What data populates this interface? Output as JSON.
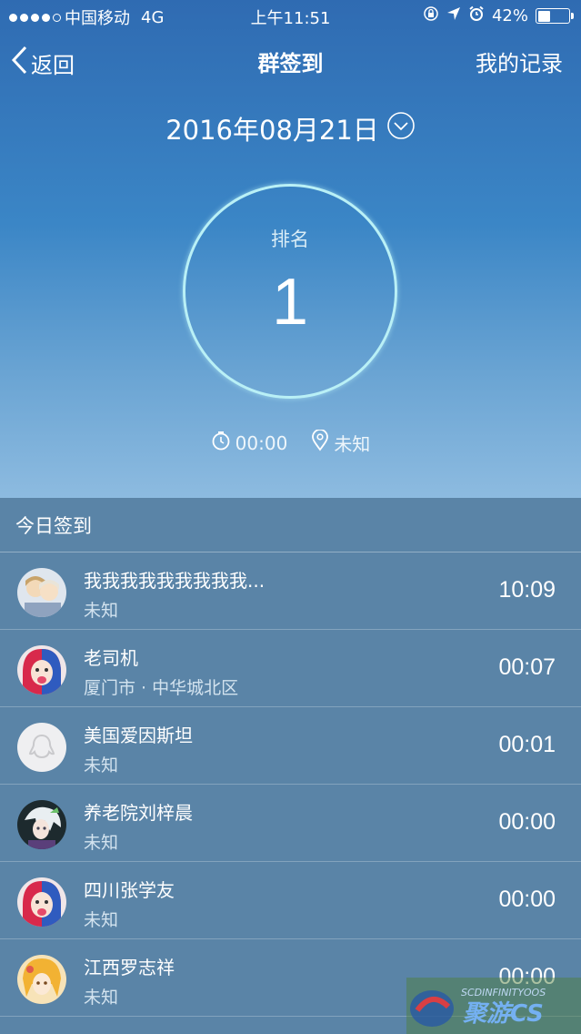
{
  "status_bar": {
    "carrier": "中国移动",
    "network": "4G",
    "time": "上午11:51",
    "battery_percent": "42%",
    "battery_level": 0.42,
    "signal_bars_filled": 4,
    "signal_bars_total": 5
  },
  "nav": {
    "back_label": "返回",
    "title": "群签到",
    "records_label": "我的记录"
  },
  "date": "2016年08月21日",
  "rank": {
    "label": "排名",
    "value": "1"
  },
  "meta": {
    "time": "00:00",
    "location": "未知"
  },
  "section_title": "今日签到",
  "checkins": [
    {
      "name": "我我我我我我我我我...",
      "location": "未知",
      "time": "10:09",
      "avatar": "anime-couple"
    },
    {
      "name": "老司机",
      "location": "厦门市 · 中华城北区",
      "time": "00:07",
      "avatar": "harley-girl"
    },
    {
      "name": "美国爱因斯坦",
      "location": "未知",
      "time": "00:01",
      "avatar": "default-penguin"
    },
    {
      "name": "养老院刘梓晨",
      "location": "未知",
      "time": "00:00",
      "avatar": "anime-white-hair"
    },
    {
      "name": "四川张学友",
      "location": "未知",
      "time": "00:00",
      "avatar": "harley-girl"
    },
    {
      "name": "江西罗志祥",
      "location": "未知",
      "time": "00:00",
      "avatar": "anime-blonde"
    }
  ],
  "watermark_text": "SCDINFINITYOOS 聚游CS",
  "colors": {
    "hero_top": "#2f6bb2",
    "hero_bottom": "#8dbbe0",
    "list_bg": "#5a84a7",
    "ring": "#b9f0f6"
  }
}
